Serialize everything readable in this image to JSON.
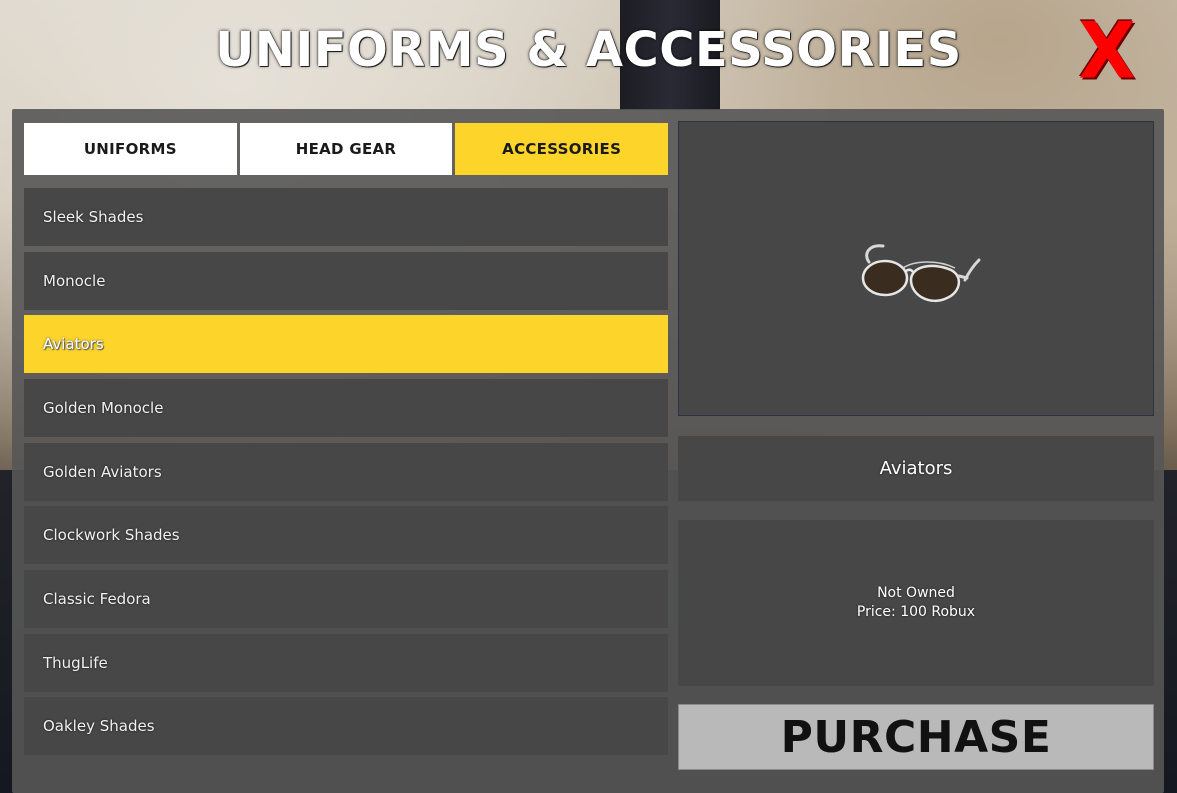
{
  "title": "UNIFORMS & ACCESSORIES",
  "close_label": "X",
  "tabs": [
    {
      "label": "UNIFORMS",
      "active": false
    },
    {
      "label": "HEAD GEAR",
      "active": false
    },
    {
      "label": "ACCESSORIES",
      "active": true
    }
  ],
  "items": [
    {
      "label": "Sleek Shades",
      "selected": false
    },
    {
      "label": "Monocle",
      "selected": false
    },
    {
      "label": "Aviators",
      "selected": true
    },
    {
      "label": "Golden Monocle",
      "selected": false
    },
    {
      "label": "Golden Aviators",
      "selected": false
    },
    {
      "label": "Clockwork Shades",
      "selected": false
    },
    {
      "label": "Classic Fedora",
      "selected": false
    },
    {
      "label": "ThugLife",
      "selected": false
    },
    {
      "label": "Oakley Shades",
      "selected": false
    }
  ],
  "preview": {
    "icon": "aviator-sunglasses-icon"
  },
  "details": {
    "name": "Aviators",
    "status": "Not Owned",
    "price": "Price: 100 Robux"
  },
  "purchase_label": "PURCHASE",
  "colors": {
    "accent": "#fdd42a",
    "close": "#ff0000",
    "panel": "#565656",
    "item": "#474747"
  }
}
